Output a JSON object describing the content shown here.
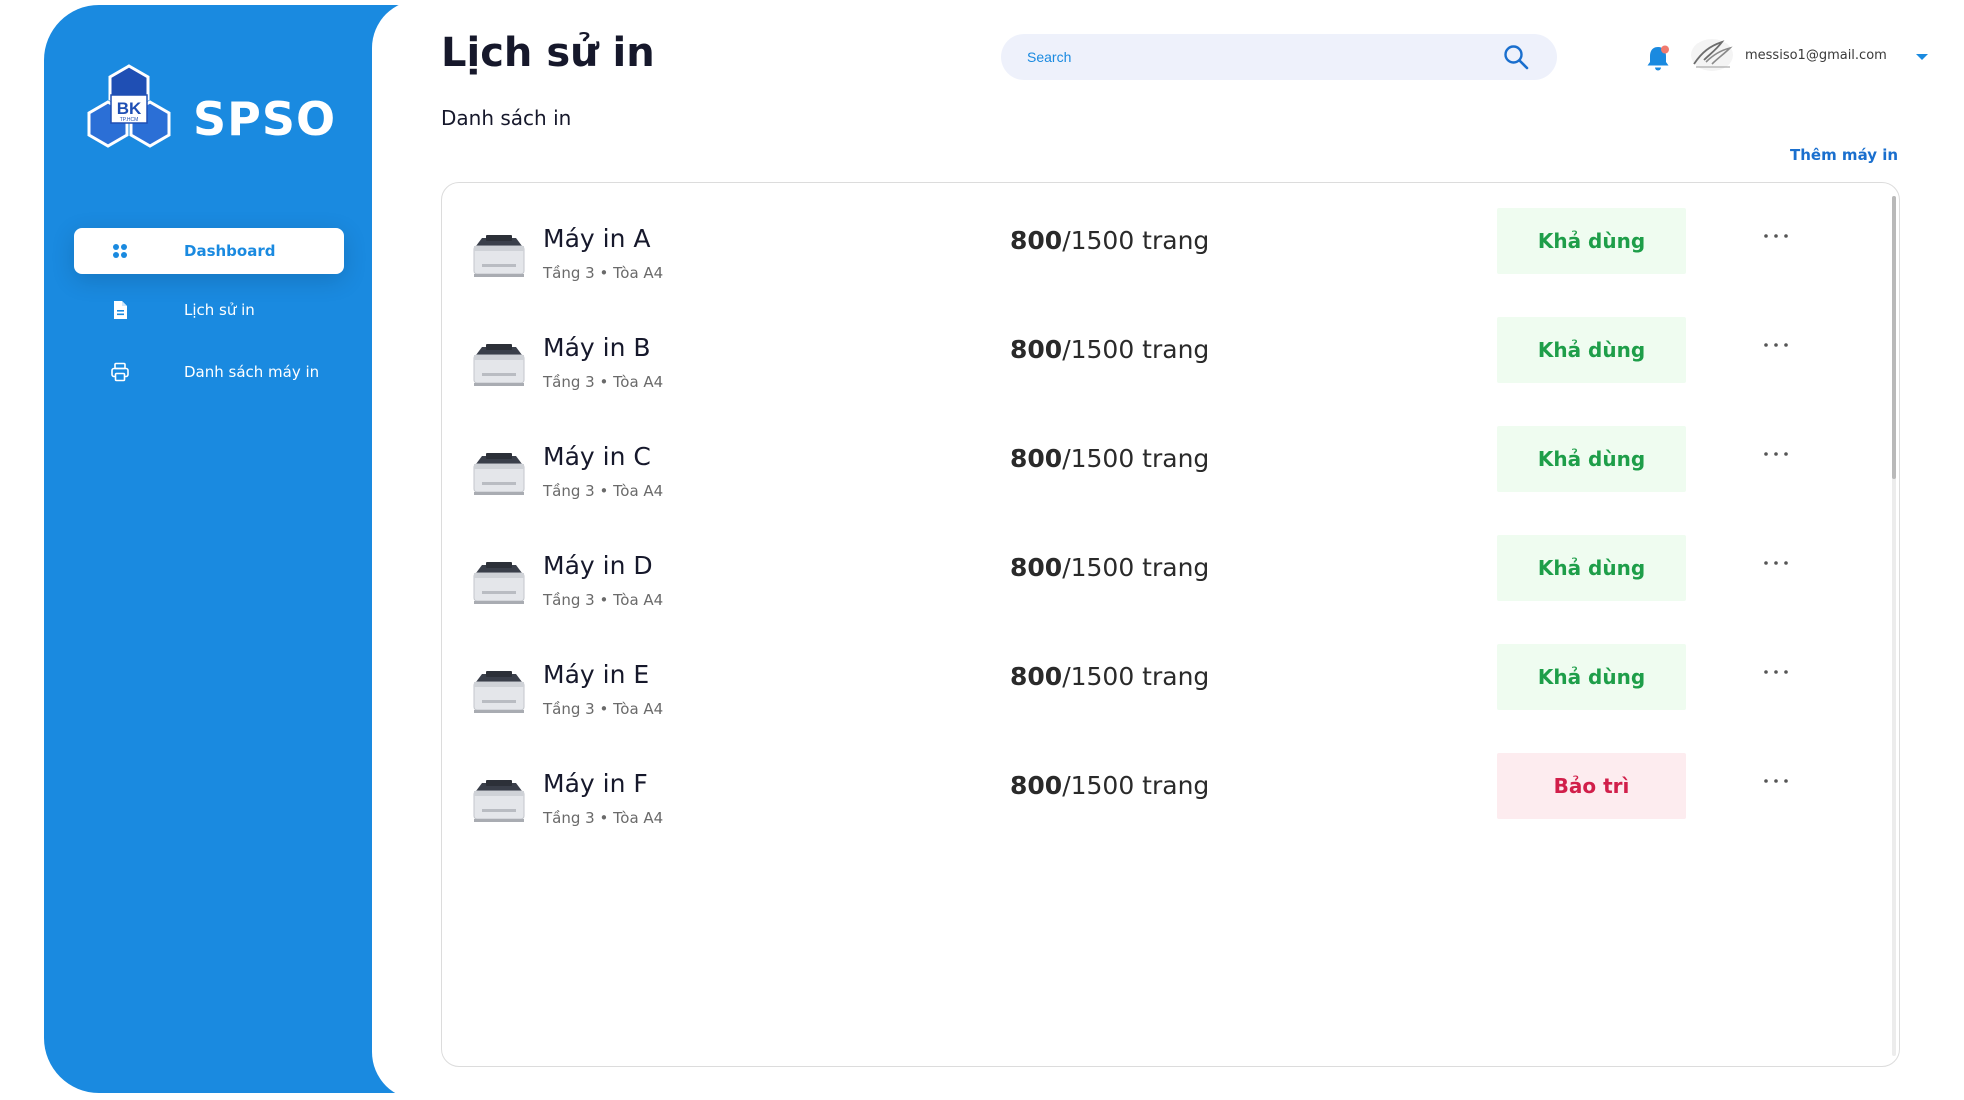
{
  "brand": {
    "name": "SPSO",
    "logo_text_main": "BK",
    "logo_text_sub": "TP.HCM"
  },
  "sidebar": {
    "items": [
      {
        "label": "Dashboard",
        "icon": "grid-icon",
        "active": true
      },
      {
        "label": "Lịch sử in",
        "icon": "document-icon",
        "active": false
      },
      {
        "label": "Danh sách máy in",
        "icon": "printer-icon",
        "active": false
      }
    ]
  },
  "header": {
    "title": "Lịch sử in",
    "search_placeholder": "Search",
    "user_email": "messiso1@gmail.com"
  },
  "main": {
    "subtitle": "Danh sách in",
    "add_printer_label": "Thêm máy in",
    "printers": [
      {
        "name": "Máy in A",
        "location": "Tầng 3 • Tòa A4",
        "used": "800",
        "total": "/1500 trang",
        "status": "Khả dùng",
        "status_type": "ok"
      },
      {
        "name": "Máy in B",
        "location": "Tầng 3 • Tòa A4",
        "used": "800",
        "total": "/1500 trang",
        "status": "Khả dùng",
        "status_type": "ok"
      },
      {
        "name": "Máy in C",
        "location": "Tầng 3 • Tòa A4",
        "used": "800",
        "total": "/1500 trang",
        "status": "Khả dùng",
        "status_type": "ok"
      },
      {
        "name": "Máy in D",
        "location": "Tầng 3 • Tòa A4",
        "used": "800",
        "total": "/1500 trang",
        "status": "Khả dùng",
        "status_type": "ok"
      },
      {
        "name": "Máy in E",
        "location": "Tầng 3 • Tòa A4",
        "used": "800",
        "total": "/1500 trang",
        "status": "Khả dùng",
        "status_type": "ok"
      },
      {
        "name": "Máy in F",
        "location": "Tầng 3 • Tòa A4",
        "used": "800",
        "total": "/1500 trang",
        "status": "Bảo trì",
        "status_type": "maint"
      }
    ]
  },
  "colors": {
    "sidebar_blue": "#1a8ae0",
    "available_text": "#1e9e49",
    "available_bg": "#effcf0",
    "maintenance_text": "#d11f4a",
    "maintenance_bg": "#fdecef"
  }
}
